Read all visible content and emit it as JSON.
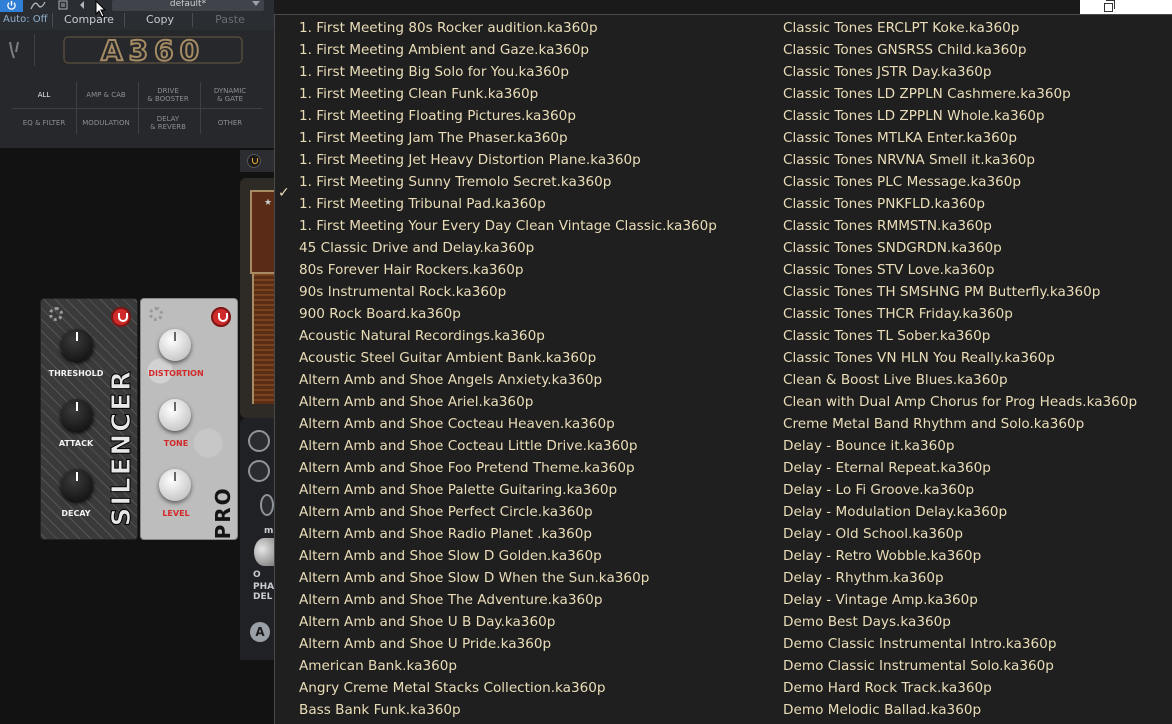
{
  "toolbar": {
    "preset_name": "default*",
    "auto_label": "Auto: Off",
    "compare_label": "Compare",
    "copy_label": "Copy",
    "paste_label": "Paste"
  },
  "header": {
    "logo_text": "A360",
    "categories": [
      {
        "label": "ALL",
        "active": true
      },
      {
        "label": "AMP & CAB"
      },
      {
        "label": "DRIVE\n& BOOSTER"
      },
      {
        "label": "DYNAMIC\n& GATE"
      },
      {
        "label": "EQ & FILTER"
      },
      {
        "label": "MODULATION"
      },
      {
        "label": "DELAY\n& REVERB"
      },
      {
        "label": "OTHER"
      }
    ]
  },
  "pedals": {
    "silencer": {
      "name": "SILENCER",
      "knobs": [
        "THRESHOLD",
        "ATTACK",
        "DECAY"
      ]
    },
    "distortion": {
      "name": "PRO DISTORTION",
      "knobs": [
        "DISTORTION",
        "TONE",
        "LEVEL"
      ]
    }
  },
  "side": {
    "label_fragment_1": "m",
    "label_fragment_2": "PHA",
    "label_fragment_3": "DEL",
    "label_fragment_0": "O",
    "a_button": "A"
  },
  "menu": {
    "checked_index": 8,
    "checkmark": "✓",
    "left_column": [
      "1. First Meeting 80s Rocker audition.ka360p",
      "1. First Meeting Ambient and Gaze.ka360p",
      "1. First Meeting Big Solo for You.ka360p",
      "1. First Meeting Clean Funk.ka360p",
      "1. First Meeting Floating Pictures.ka360p",
      "1. First Meeting Jam The Phaser.ka360p",
      "1. First Meeting Jet Heavy Distortion Plane.ka360p",
      "1. First Meeting Sunny Tremolo Secret.ka360p",
      "1. First Meeting Tribunal Pad.ka360p",
      "1. First Meeting Your Every Day Clean Vintage Classic.ka360p",
      "45 Classic Drive and Delay.ka360p",
      "80s Forever Hair Rockers.ka360p",
      "90s Instrumental Rock.ka360p",
      "900 Rock Board.ka360p",
      "Acoustic Natural Recordings.ka360p",
      "Acoustic Steel Guitar Ambient Bank.ka360p",
      "Altern Amb and Shoe Angels Anxiety.ka360p",
      "Altern Amb and Shoe Ariel.ka360p",
      "Altern Amb and Shoe Cocteau Heaven.ka360p",
      "Altern Amb and Shoe Cocteau Little Drive.ka360p",
      "Altern Amb and Shoe Foo Pretend Theme.ka360p",
      "Altern Amb and Shoe Palette Guitaring.ka360p",
      "Altern Amb and Shoe Perfect Circle.ka360p",
      "Altern Amb and Shoe Radio Planet .ka360p",
      "Altern Amb and Shoe Slow D Golden.ka360p",
      "Altern Amb and Shoe Slow D When the Sun.ka360p",
      "Altern Amb and Shoe The Adventure.ka360p",
      "Altern Amb and Shoe U B Day.ka360p",
      "Altern Amb and Shoe U Pride.ka360p",
      "American Bank.ka360p",
      "Angry Creme Metal Stacks Collection.ka360p",
      "Bass Bank Funk.ka360p"
    ],
    "right_column": [
      "Classic Tones ERCLPT Koke.ka360p",
      "Classic Tones GNSRSS Child.ka360p",
      "Classic Tones JSTR Day.ka360p",
      "Classic Tones LD ZPPLN Cashmere.ka360p",
      "Classic Tones LD ZPPLN Whole.ka360p",
      "Classic Tones MTLKA Enter.ka360p",
      "Classic Tones NRVNA Smell it.ka360p",
      "Classic Tones PLC Message.ka360p",
      "Classic Tones PNKFLD.ka360p",
      "Classic Tones RMMSTN.ka360p",
      "Classic Tones SNDGRDN.ka360p",
      "Classic Tones STV Love.ka360p",
      "Classic Tones TH SMSHNG PM Butterfly.ka360p",
      "Classic Tones THCR Friday.ka360p",
      "Classic Tones TL Sober.ka360p",
      "Classic Tones VN HLN You Really.ka360p",
      "Clean & Boost Live Blues.ka360p",
      "Clean with Dual Amp Chorus for Prog Heads.ka360p",
      "Creme Metal Band Rhythm and Solo.ka360p",
      "Delay - Bounce it.ka360p",
      "Delay - Eternal Repeat.ka360p",
      "Delay - Lo Fi Groove.ka360p",
      "Delay - Modulation Delay.ka360p",
      "Delay - Old School.ka360p",
      "Delay - Retro Wobble.ka360p",
      "Delay - Rhythm.ka360p",
      "Delay - Vintage Amp.ka360p",
      "Demo Best Days.ka360p",
      "Demo Classic Instrumental Intro.ka360p",
      "Demo Classic Instrumental Solo.ka360p",
      "Demo Hard Rock Track.ka360p",
      "Demo Melodic Ballad.ka360p"
    ]
  }
}
